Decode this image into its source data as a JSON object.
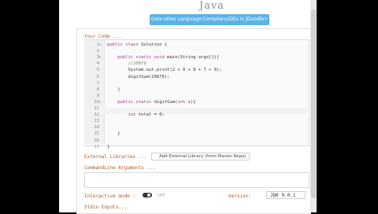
{
  "header": {
    "title": "Java",
    "goto_button": "Goto other Language Compilers/IDEs in JDoodle+"
  },
  "editor": {
    "label": "Your Code ...",
    "lines": [
      {
        "num": "1",
        "fold": "▾",
        "code": "public class Solution {"
      },
      {
        "num": "2",
        "fold": "",
        "code": ""
      },
      {
        "num": "3",
        "fold": "▾",
        "code": "    public static void main(String args[]){"
      },
      {
        "num": "4",
        "fold": "",
        "code": "        //20879"
      },
      {
        "num": "5",
        "fold": "",
        "code": "        System.out.print(2 + 0 + 8 + 7 + 9);"
      },
      {
        "num": "6",
        "fold": "",
        "code": "        digitSum(20879);"
      },
      {
        "num": "7",
        "fold": "",
        "code": ""
      },
      {
        "num": "8",
        "fold": "",
        "code": "    }"
      },
      {
        "num": "9",
        "fold": "",
        "code": ""
      },
      {
        "num": "10",
        "fold": "▾",
        "code": "    public static digitSum(int x){"
      },
      {
        "num": "11",
        "fold": "",
        "code": ""
      },
      {
        "num": "12",
        "fold": "",
        "code": "        int total = 0;"
      },
      {
        "num": "13",
        "fold": "",
        "code": ""
      },
      {
        "num": "14",
        "fold": "",
        "code": ""
      },
      {
        "num": "15",
        "fold": "",
        "code": "    }"
      },
      {
        "num": "16",
        "fold": "",
        "code": ""
      },
      {
        "num": "17",
        "fold": "",
        "code": "}"
      }
    ]
  },
  "external": {
    "label": "External Libraries ...",
    "button": "Add External Library (from Maven Repo)"
  },
  "cmdline": {
    "label": "CommandLine Arguments ..."
  },
  "interactive": {
    "label": "Interactive mode :",
    "state": "OFF"
  },
  "version": {
    "label": "Version:",
    "value": "JDK 9.0.1"
  },
  "stdin": {
    "label": "Stdin Inputs..."
  },
  "colors": {
    "accent": "#5bb3e6",
    "label": "#b05a2a",
    "keyword": "#a0327a"
  }
}
